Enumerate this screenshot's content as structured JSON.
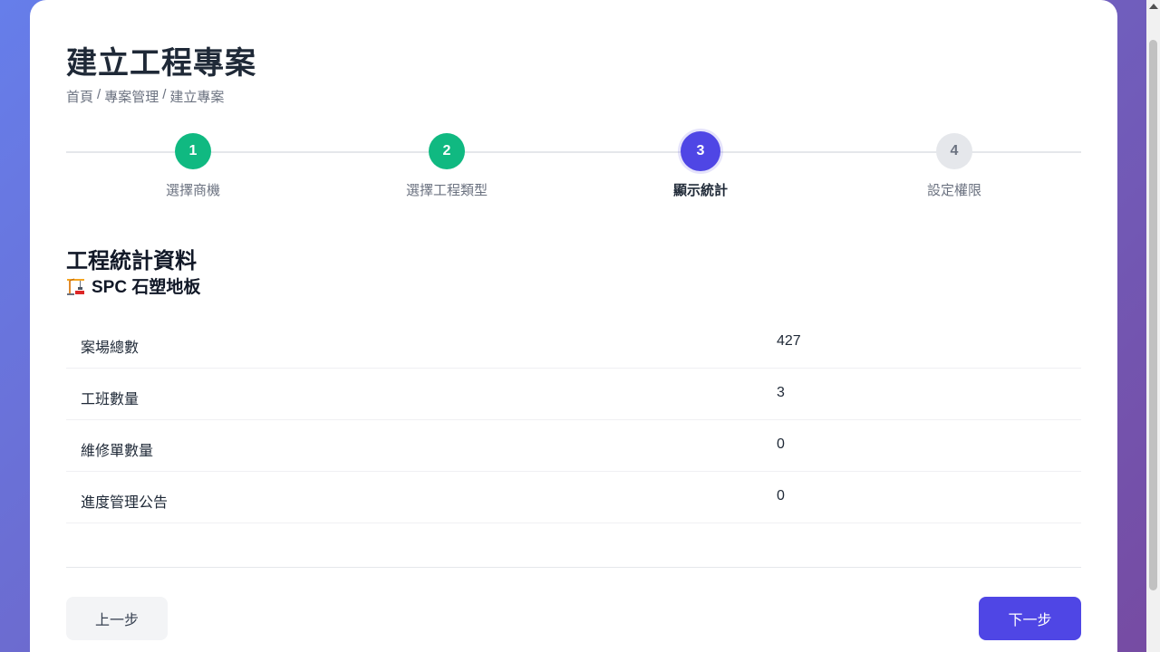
{
  "header": {
    "title": "建立工程專案",
    "breadcrumb": [
      "首頁",
      "/",
      "專案管理",
      "/",
      "建立專案"
    ]
  },
  "steps": [
    {
      "number": "1",
      "label": "選擇商機",
      "status": "done"
    },
    {
      "number": "2",
      "label": "選擇工程類型",
      "status": "done"
    },
    {
      "number": "3",
      "label": "顯示統計",
      "status": "active"
    },
    {
      "number": "4",
      "label": "設定權限",
      "status": "todo"
    }
  ],
  "main": {
    "section_title": "工程統計資料",
    "project_type_icon": "construction-crane-icon",
    "project_type": "SPC 石塑地板",
    "stats": [
      {
        "label": "案場總數",
        "value": "427"
      },
      {
        "label": "工班數量",
        "value": "3"
      },
      {
        "label": "維修單數量",
        "value": "0"
      },
      {
        "label": "進度管理公告",
        "value": "0"
      }
    ]
  },
  "footer": {
    "prev_label": "上一步",
    "next_label": "下一步"
  },
  "colors": {
    "accent": "#4f46e5",
    "done": "#10b981",
    "todo": "#e5e7eb"
  }
}
